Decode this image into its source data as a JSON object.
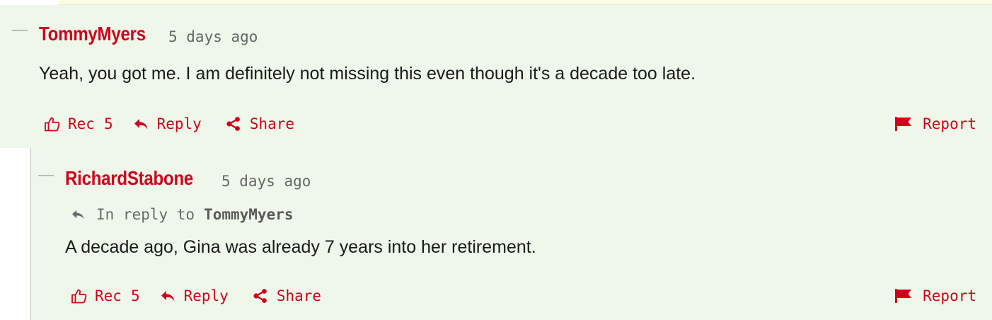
{
  "comments": [
    {
      "author": "TommyMyers",
      "time": "5 days ago",
      "body": "Yeah, you got me. I am definitely not missing this even though it's a decade too late.",
      "rec_label": "Rec",
      "rec_count": "5",
      "reply_label": "Reply",
      "share_label": "Share",
      "report_label": "Report"
    },
    {
      "author": "RichardStabone",
      "time": "5 days ago",
      "in_reply_prefix": "In reply to",
      "in_reply_target": "TommyMyers",
      "body": "A decade ago, Gina was already 7 years into her retirement.",
      "rec_label": "Rec",
      "rec_count": "5",
      "reply_label": "Reply",
      "share_label": "Share",
      "report_label": "Report"
    }
  ],
  "icons": {
    "recommend": "thumbs-up-outline-icon",
    "reply": "reply-arrow-icon",
    "share": "share-nodes-icon",
    "report": "flag-icon",
    "collapse": "minus-icon"
  },
  "colors": {
    "accent": "#d0021b",
    "comment_background": "#eef7ea",
    "top_strip": "#fdfbe6"
  }
}
